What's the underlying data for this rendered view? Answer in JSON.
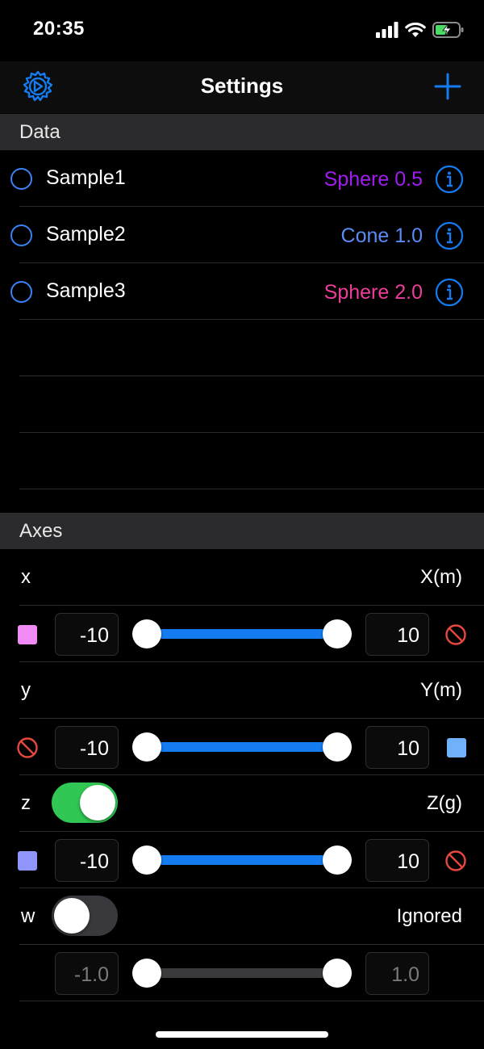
{
  "status_bar": {
    "time": "20:35",
    "icons": [
      "signal-icon",
      "wifi-icon",
      "battery-charging-icon"
    ]
  },
  "nav": {
    "title": "Settings",
    "left_icon": "settings-gear-icon",
    "right_icon": "plus-icon"
  },
  "colors": {
    "accent": "#3b82f6",
    "slider": "#147cf0",
    "toggle_on": "#31c754",
    "destructive": "#e5483f"
  },
  "data_section": {
    "header": "Data",
    "items": [
      {
        "name": "Sample1",
        "value": "Sphere 0.5",
        "color": "#a21cf2"
      },
      {
        "name": "Sample2",
        "value": "Cone 1.0",
        "color": "#5b8bf5"
      },
      {
        "name": "Sample3",
        "value": "Sphere 2.0",
        "color": "#ec3d9a"
      }
    ]
  },
  "axes_section": {
    "header": "Axes",
    "axes": [
      {
        "label": "x",
        "unit": "X(m)",
        "min": "-10",
        "max": "10",
        "enabled": true,
        "left_control": "color-swatch",
        "left_color": "#f08af4",
        "right_control": "no-symbol-icon",
        "slider_low": 0.0,
        "slider_high": 1.0
      },
      {
        "label": "y",
        "unit": "Y(m)",
        "min": "-10",
        "max": "10",
        "enabled": true,
        "left_control": "no-symbol-icon",
        "right_control": "color-swatch",
        "right_color": "#6fb2fb",
        "slider_low": 0.0,
        "slider_high": 1.0
      },
      {
        "label": "z",
        "unit": "Z(g)",
        "min": "-10",
        "max": "10",
        "enabled": true,
        "toggle": "on",
        "left_control": "color-swatch",
        "left_color": "#8f95fb",
        "right_control": "no-symbol-icon",
        "slider_low": 0.0,
        "slider_high": 1.0
      },
      {
        "label": "w",
        "unit": "Ignored",
        "min": "-1.0",
        "max": "1.0",
        "enabled": false,
        "toggle": "off",
        "slider_low": 0.0,
        "slider_high": 1.0
      }
    ]
  }
}
